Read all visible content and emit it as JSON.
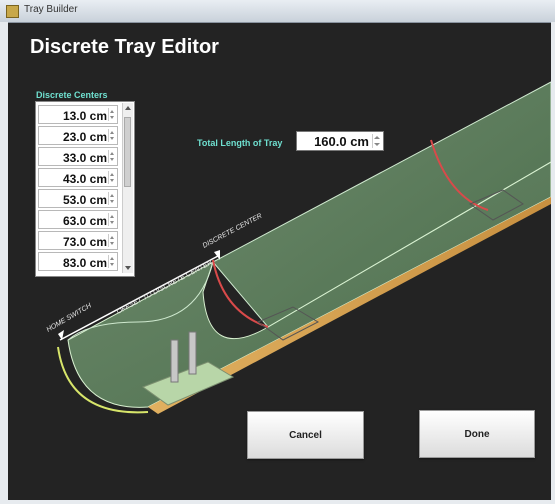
{
  "window": {
    "title": "Tray Builder"
  },
  "heading": "Discrete Tray Editor",
  "discrete_centers": {
    "label": "Discrete Centers",
    "values": [
      "13.0 cm",
      "23.0 cm",
      "33.0 cm",
      "43.0 cm",
      "53.0 cm",
      "63.0 cm",
      "73.0 cm",
      "83.0 cm"
    ]
  },
  "total_length": {
    "label": "Total Length of Tray",
    "value": "160.0 cm"
  },
  "annotations": {
    "home_switch": "HOME SWITCH",
    "offset": "OFFSET TO DISCRETE CENTER",
    "discrete_center": "DISCRETE CENTER"
  },
  "buttons": {
    "cancel": "Cancel",
    "done": "Done"
  },
  "colors": {
    "accent_text": "#6fe0d0",
    "tray": "#9fd79a",
    "marker": "#d94a4a"
  }
}
